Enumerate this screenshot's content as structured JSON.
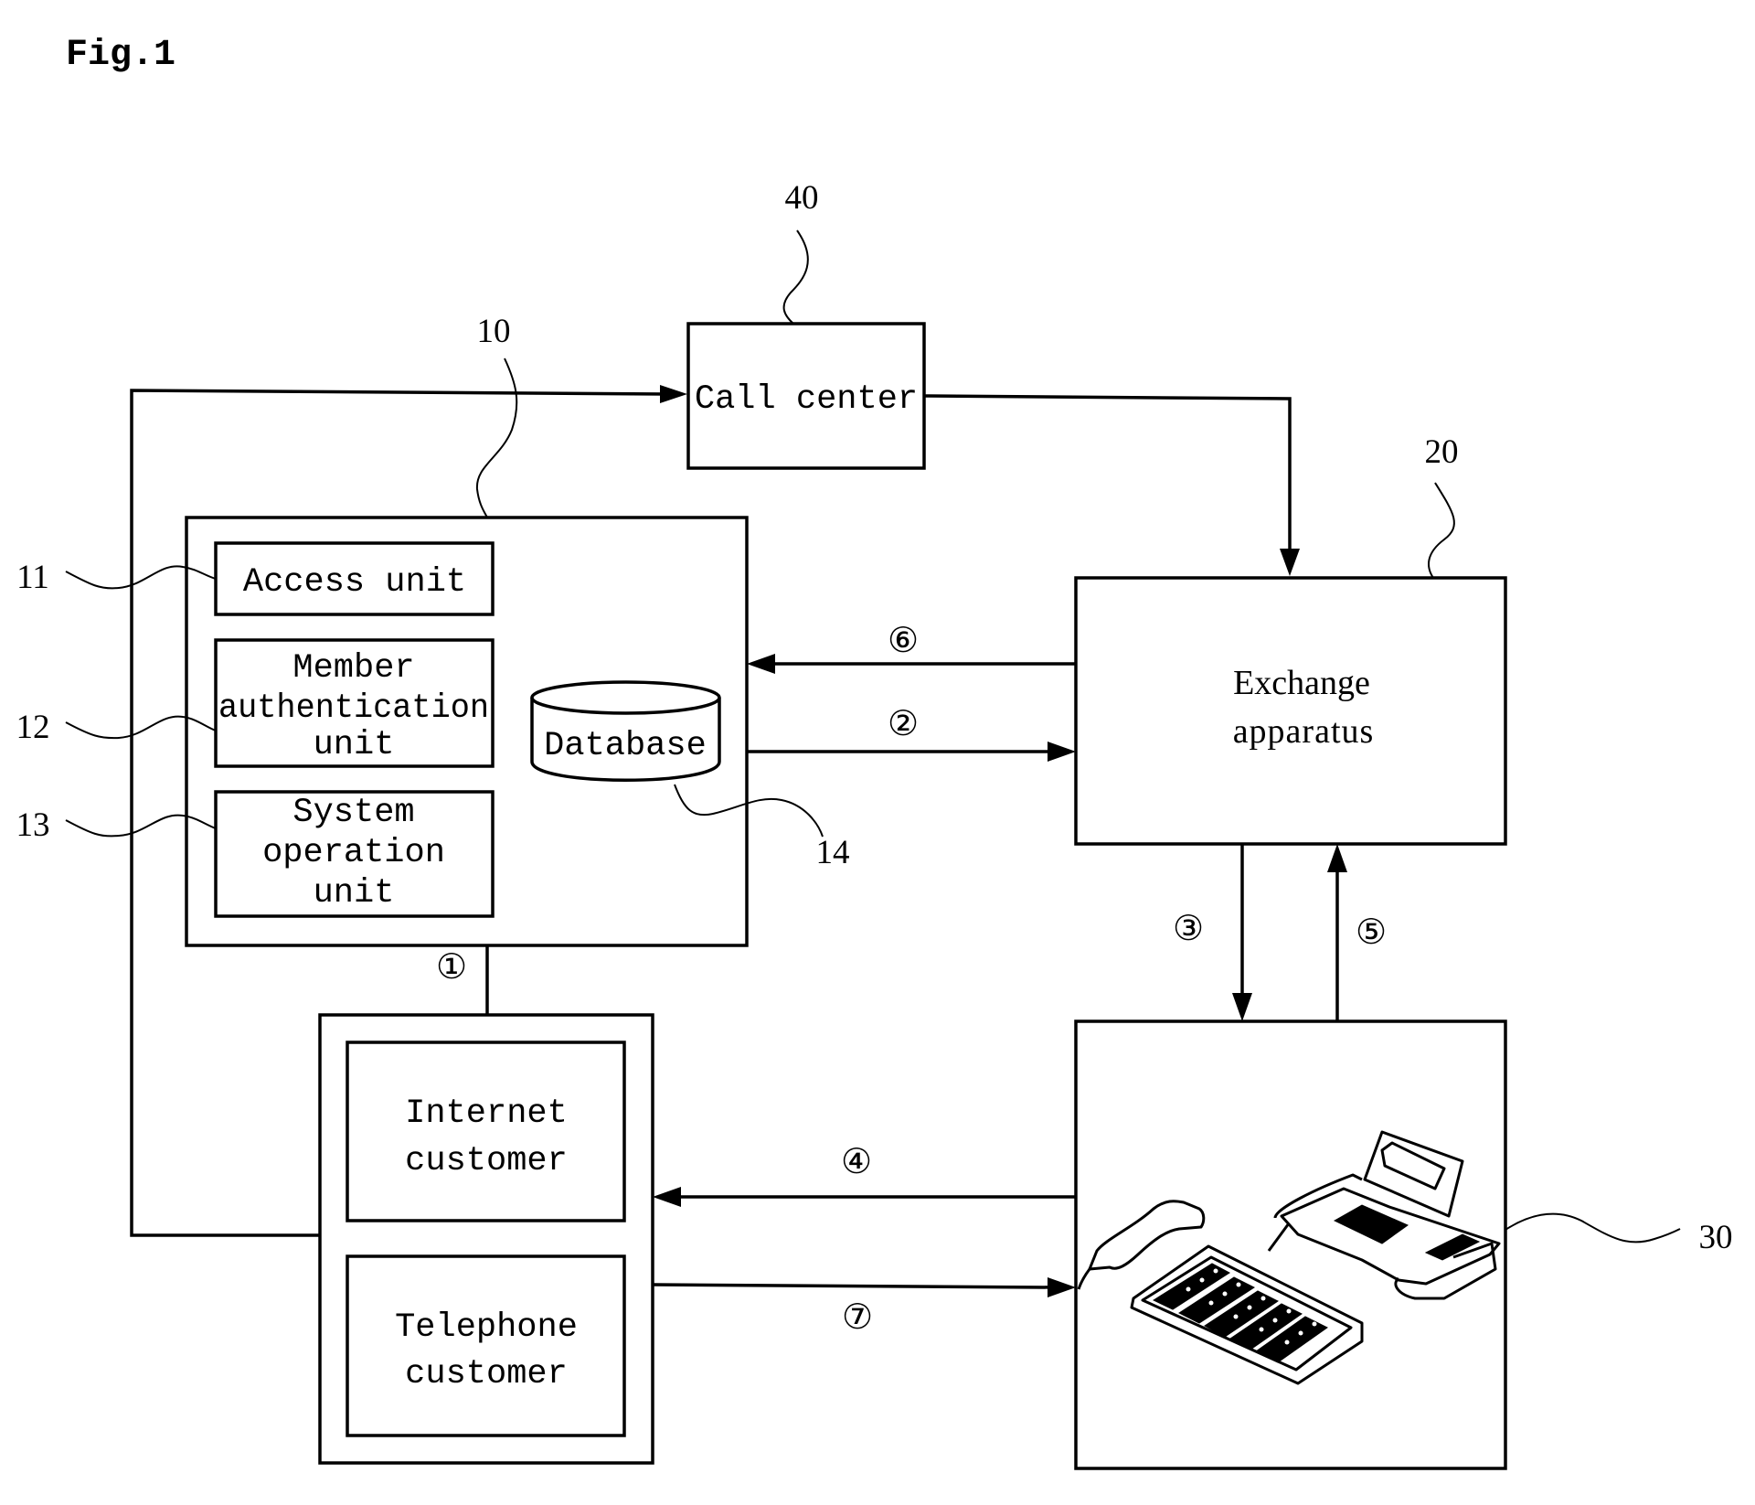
{
  "figure": {
    "title": "Fig.1"
  },
  "components": {
    "call_center": {
      "ref": "40",
      "label": "Call center"
    },
    "server": {
      "ref": "10",
      "units": [
        {
          "ref": "11",
          "lines": [
            "Access unit"
          ]
        },
        {
          "ref": "12",
          "lines": [
            "Member",
            "authentication",
            "unit"
          ]
        },
        {
          "ref": "13",
          "lines": [
            "System",
            "operation",
            "unit"
          ]
        }
      ],
      "database": {
        "ref": "14",
        "label": "Database"
      }
    },
    "exchange": {
      "ref": "20",
      "lines": [
        "Exchange",
        "apparatus"
      ]
    },
    "terminal": {
      "ref": "30",
      "devices": [
        "handset",
        "keyboard",
        "fax-phone"
      ]
    },
    "customers": {
      "internet": {
        "lines": [
          "Internet",
          "customer"
        ]
      },
      "telephone": {
        "lines": [
          "Telephone",
          "customer"
        ]
      }
    }
  },
  "steps": [
    {
      "id": "1",
      "symbol": "①",
      "from": "customers",
      "to": "server"
    },
    {
      "id": "2",
      "symbol": "②",
      "from": "server",
      "to": "exchange"
    },
    {
      "id": "3",
      "symbol": "③",
      "from": "exchange",
      "to": "terminal"
    },
    {
      "id": "4",
      "symbol": "④",
      "from": "terminal",
      "to": "customers"
    },
    {
      "id": "5",
      "symbol": "⑤",
      "from": "terminal",
      "to": "exchange"
    },
    {
      "id": "6",
      "symbol": "⑥",
      "from": "exchange",
      "to": "server"
    },
    {
      "id": "7",
      "symbol": "⑦",
      "from": "customers",
      "to": "terminal"
    }
  ],
  "connections": [
    {
      "from": "customers",
      "to": "call_center",
      "directed": true
    },
    {
      "from": "call_center",
      "to": "exchange",
      "directed": true
    }
  ]
}
